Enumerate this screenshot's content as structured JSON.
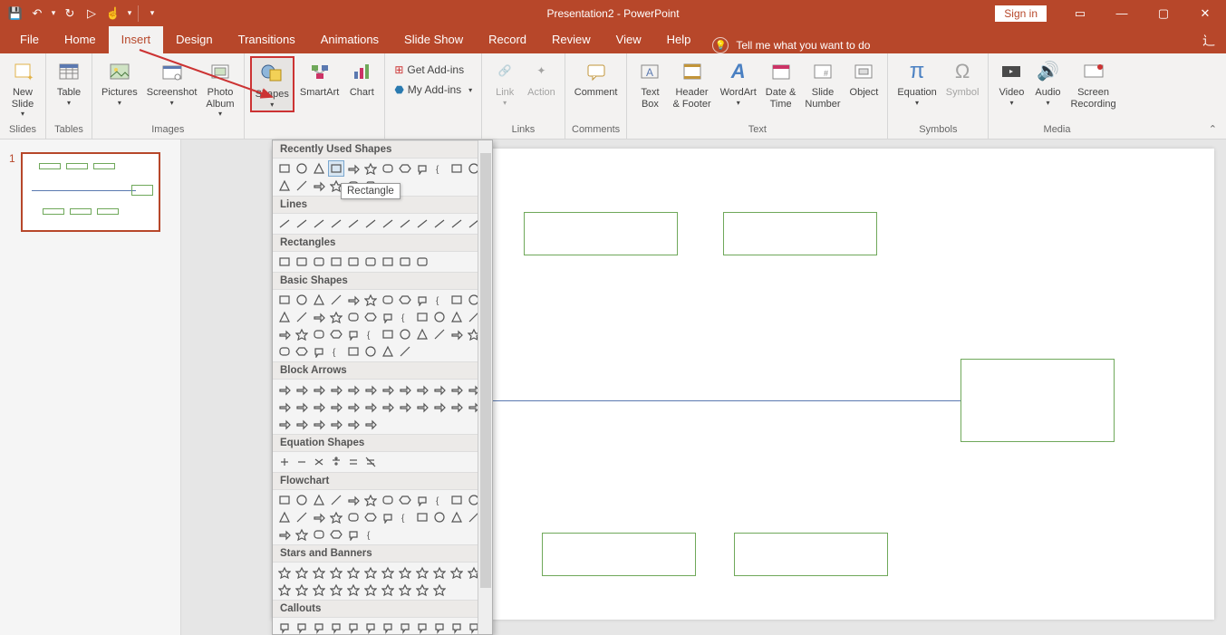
{
  "titlebar": {
    "doc_title": "Presentation2  -  PowerPoint",
    "signin": "Sign in"
  },
  "qat": {
    "save": "💾",
    "undo": "↶",
    "redo": "↻",
    "start": "▷",
    "touch": "☝"
  },
  "tabs": {
    "file": "File",
    "home": "Home",
    "insert": "Insert",
    "design": "Design",
    "transitions": "Transitions",
    "animations": "Animations",
    "slideshow": "Slide Show",
    "record": "Record",
    "review": "Review",
    "view": "View",
    "help": "Help",
    "tellme": "Tell me what you want to do"
  },
  "ribbon": {
    "groups": {
      "slides": "Slides",
      "tables": "Tables",
      "images": "Images",
      "links": "Links",
      "comments": "Comments",
      "text": "Text",
      "symbols": "Symbols",
      "media": "Media"
    },
    "buttons": {
      "new_slide": "New\nSlide",
      "table": "Table",
      "pictures": "Pictures",
      "screenshot": "Screenshot",
      "photo_album": "Photo\nAlbum",
      "shapes": "Shapes",
      "smartart": "SmartArt",
      "chart": "Chart",
      "get_addins": "Get Add-ins",
      "my_addins": "My Add-ins",
      "link": "Link",
      "action": "Action",
      "comment": "Comment",
      "text_box": "Text\nBox",
      "header_footer": "Header\n& Footer",
      "wordart": "WordArt",
      "date_time": "Date &\nTime",
      "slide_number": "Slide\nNumber",
      "object": "Object",
      "equation": "Equation",
      "symbol": "Symbol",
      "video": "Video",
      "audio": "Audio",
      "screen_recording": "Screen\nRecording"
    }
  },
  "shapes_panel": {
    "tooltip": "Rectangle",
    "cats": {
      "recent": "Recently Used Shapes",
      "lines": "Lines",
      "rectangles": "Rectangles",
      "basic": "Basic Shapes",
      "block_arrows": "Block Arrows",
      "equation": "Equation Shapes",
      "flowchart": "Flowchart",
      "stars": "Stars and Banners",
      "callouts": "Callouts"
    }
  },
  "thumbs": {
    "slide1_num": "1"
  }
}
